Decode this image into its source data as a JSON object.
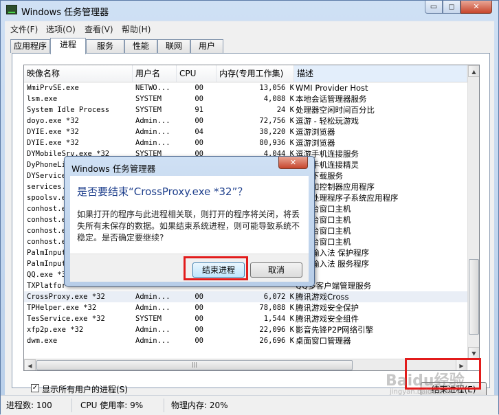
{
  "window": {
    "title": "Windows 任务管理器",
    "caption_min": "▭",
    "caption_max": "◻",
    "caption_close": "✕"
  },
  "menu": [
    "文件(F)",
    "选项(O)",
    "查看(V)",
    "帮助(H)"
  ],
  "tabs": [
    "应用程序",
    "进程",
    "服务",
    "性能",
    "联网",
    "用户"
  ],
  "active_tab": "进程",
  "columns": [
    "映像名称",
    "用户名",
    "CPU",
    "内存(专用工作集)",
    "描述"
  ],
  "processes": [
    {
      "name": "WmiPrvSE.exe",
      "user": "NETWO...",
      "cpu": "00",
      "mem": "13,056 K",
      "desc": "WMI Provider Host"
    },
    {
      "name": "lsm.exe",
      "user": "SYSTEM",
      "cpu": "00",
      "mem": "4,088 K",
      "desc": "本地会话管理器服务"
    },
    {
      "name": "System Idle Process",
      "user": "SYSTEM",
      "cpu": "91",
      "mem": "24 K",
      "desc": "处理器空闲时间百分比"
    },
    {
      "name": "doyo.exe *32",
      "user": "Admin...",
      "cpu": "00",
      "mem": "72,756 K",
      "desc": "逗游 - 轻松玩游戏"
    },
    {
      "name": "DYIE.exe *32",
      "user": "Admin...",
      "cpu": "04",
      "mem": "38,220 K",
      "desc": "逗游浏览器"
    },
    {
      "name": "DYIE.exe *32",
      "user": "Admin...",
      "cpu": "00",
      "mem": "80,936 K",
      "desc": "逗游浏览器"
    },
    {
      "name": "DYMobileSrv.exe *32",
      "user": "SYSTEM",
      "cpu": "00",
      "mem": "4,044 K",
      "desc": "逗游手机连接服务"
    },
    {
      "name": "DyPhoneLi",
      "user": "",
      "cpu": "",
      "mem": "",
      "desc": "逗游手机连接精灵"
    },
    {
      "name": "DYService",
      "user": "",
      "cpu": "",
      "mem": "",
      "desc": "逗游下载服务"
    },
    {
      "name": "services.",
      "user": "",
      "cpu": "",
      "mem": "",
      "desc": "服务和控制器应用程序"
    },
    {
      "name": "spoolsv.e",
      "user": "",
      "cpu": "",
      "mem": "",
      "desc": "后台处理程序子系统应用程序"
    },
    {
      "name": "conhost.e",
      "user": "",
      "cpu": "",
      "mem": "",
      "desc": "控制台窗口主机"
    },
    {
      "name": "conhost.e",
      "user": "",
      "cpu": "",
      "mem": "",
      "desc": "控制台窗口主机"
    },
    {
      "name": "conhost.e",
      "user": "",
      "cpu": "",
      "mem": "",
      "desc": "控制台窗口主机"
    },
    {
      "name": "conhost.e",
      "user": "",
      "cpu": "",
      "mem": "",
      "desc": "控制台窗口主机"
    },
    {
      "name": "PalmInput",
      "user": "",
      "cpu": "",
      "mem": "",
      "desc": "手心输入法 保护程序"
    },
    {
      "name": "PalmInput",
      "user": "",
      "cpu": "",
      "mem": "",
      "desc": "手心输入法 服务程序"
    },
    {
      "name": "QQ.exe *3",
      "user": "",
      "cpu": "",
      "mem": "",
      "desc": "QQ"
    },
    {
      "name": "TXPlatfor",
      "user": "",
      "cpu": "",
      "mem": "",
      "desc": "QQ多客户端管理服务"
    },
    {
      "name": "CrossProxy.exe *32",
      "user": "Admin...",
      "cpu": "00",
      "mem": "6,072 K",
      "desc": "腾讯游戏Cross"
    },
    {
      "name": "TPHelper.exe *32",
      "user": "Admin...",
      "cpu": "00",
      "mem": "78,088 K",
      "desc": "腾讯游戏安全保护"
    },
    {
      "name": "TesService.exe *32",
      "user": "SYSTEM",
      "cpu": "00",
      "mem": "1,544 K",
      "desc": "腾讯游戏安全组件"
    },
    {
      "name": "xfp2p.exe *32",
      "user": "Admin...",
      "cpu": "00",
      "mem": "22,096 K",
      "desc": "影音先锋P2P网络引擎"
    },
    {
      "name": "dwm.exe",
      "user": "Admin...",
      "cpu": "00",
      "mem": "26,696 K",
      "desc": "桌面窗口管理器"
    }
  ],
  "selected_process_index": 19,
  "show_all_users": {
    "checked": true,
    "label": "显示所有用户的进程(S)"
  },
  "end_process_button": "结束进程(E)",
  "status": {
    "processes": "进程数: 100",
    "cpu": "CPU 使用率: 9%",
    "memory": "物理内存: 20%"
  },
  "watermark": {
    "text": "Baidu经验",
    "sub": "jingyan.baidu.com"
  },
  "dialog": {
    "title": "Windows 任务管理器",
    "close": "✕",
    "heading": "是否要结束“CrossProxy.exe *32”？",
    "message": "如果打开的程序与此进程相关联，则打开的程序将关闭，将丢失所有未保存的数据。如果结束系统进程，则可能导致系统不稳定。是否确定要继续?",
    "confirm": "结束进程",
    "cancel": "取消"
  },
  "colors": {
    "highlight_box": "#e21b1b",
    "heading_blue": "#1e3f8c"
  }
}
